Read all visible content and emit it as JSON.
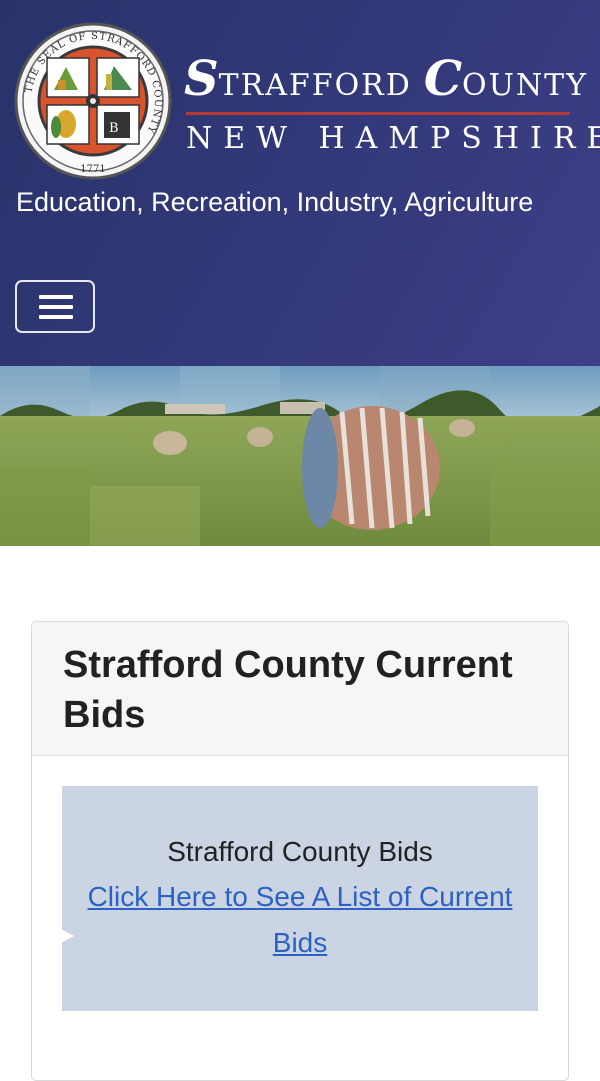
{
  "header": {
    "seal": {
      "ring_text": "THE SEAL OF STRAFFORD COUNTY",
      "year": "1771"
    },
    "title": {
      "line1_word1_cap": "S",
      "line1_word1_rest": "TRAFFORD",
      "line1_word2_cap": "C",
      "line1_word2_rest": "OUNTY",
      "line2": "NEW HAMPSHIRE"
    },
    "tagline": "Education, Recreation, Industry, Agriculture",
    "menu_icon": "hamburger-menu-icon"
  },
  "hero": {
    "description_icon": "hay-bale-field-banner"
  },
  "card": {
    "title": "Strafford County Current Bids",
    "bid_label": "Strafford County Bids",
    "bid_link": "Click Here to See A List of Current Bids"
  },
  "colors": {
    "header_bg": "#2e3670",
    "accent_rule": "#b63a37",
    "card_header_bg": "#f6f6f6",
    "bid_box_bg": "#cbd4e2",
    "link": "#2b62c4"
  }
}
